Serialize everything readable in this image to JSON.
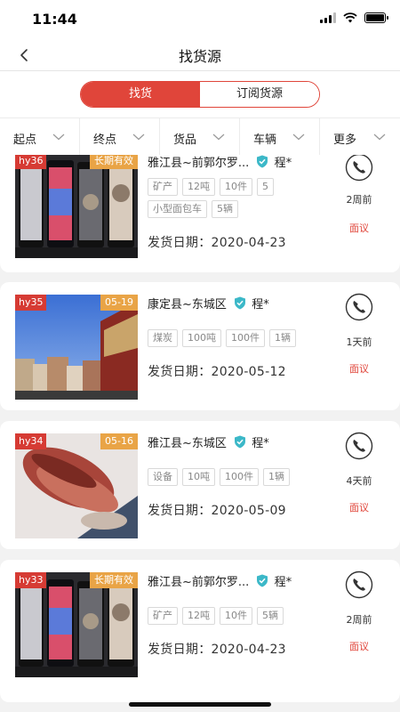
{
  "status_bar": {
    "time": "11:44"
  },
  "nav": {
    "title": "找货源"
  },
  "segment": {
    "tab_goods": "找货",
    "tab_subscribe": "订阅货源"
  },
  "filters": [
    {
      "label": "起点"
    },
    {
      "label": "终点"
    },
    {
      "label": "货品"
    },
    {
      "label": "车辆"
    },
    {
      "label": "更多"
    }
  ],
  "colors": {
    "accent": "#e0453a",
    "id_tag": "#d63b34",
    "date_tag": "#e9a446",
    "verified": "#3cb8c8"
  },
  "listings": [
    {
      "id": "hy36",
      "validity": "长期有效",
      "route": "雅江县~前郭尔罗...",
      "owner": "程*",
      "tags": [
        "矿产",
        "12吨",
        "10件",
        "5",
        "小型面包车",
        "5辆"
      ],
      "date": "发货日期：2020-04-23",
      "ago": "2周前",
      "price": "面议",
      "image": "phones-display"
    },
    {
      "id": "hy35",
      "validity": "05-19",
      "route": "康定县~东城区",
      "owner": "程*",
      "tags": [
        "煤炭",
        "100吨",
        "100件",
        "1辆"
      ],
      "date": "发货日期：2020-05-12",
      "ago": "1天前",
      "price": "面议",
      "image": "street-scene"
    },
    {
      "id": "hy34",
      "validity": "05-16",
      "route": "雅江县~东城区",
      "owner": "程*",
      "tags": [
        "设备",
        "10吨",
        "100件",
        "1辆"
      ],
      "date": "发货日期：2020-05-09",
      "ago": "4天前",
      "price": "面议",
      "image": "meat-closeup"
    },
    {
      "id": "hy33",
      "validity": "长期有效",
      "route": "雅江县~前郭尔罗...",
      "owner": "程*",
      "tags": [
        "矿产",
        "12吨",
        "10件",
        "5辆"
      ],
      "date": "发货日期：2020-04-23",
      "ago": "2周前",
      "price": "面议",
      "image": "phones-display"
    }
  ]
}
